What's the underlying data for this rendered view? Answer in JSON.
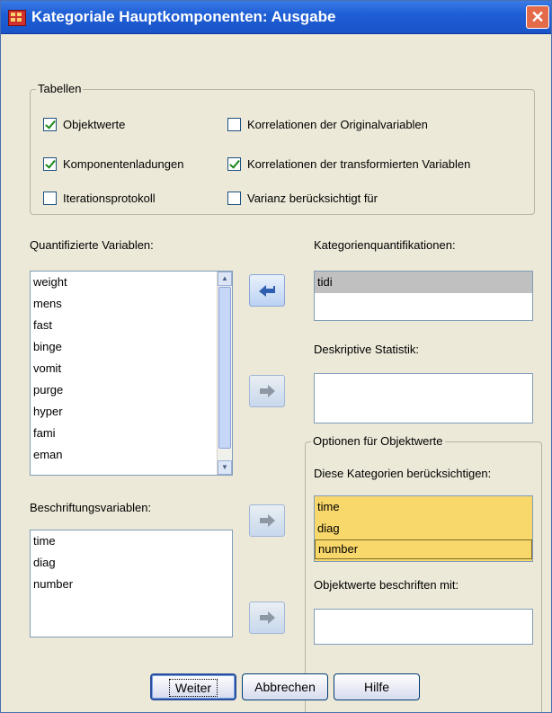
{
  "window": {
    "title": "Kategoriale Hauptkomponenten: Ausgabe",
    "close_label": "✕"
  },
  "tables_group": {
    "legend": "Tabellen",
    "checkboxes": [
      {
        "label": "Objektwerte",
        "checked": true
      },
      {
        "label": "Komponentenladungen",
        "checked": true
      },
      {
        "label": "Iterationsprotokoll",
        "checked": false
      },
      {
        "label": "Korrelationen der Originalvariablen",
        "checked": false
      },
      {
        "label": "Korrelationen der transformierten Variablen",
        "checked": true
      },
      {
        "label": "Varianz berücksichtigt für",
        "checked": false
      }
    ]
  },
  "quantified": {
    "label": "Quantifizierte Variablen:",
    "items": [
      "weight",
      "mens",
      "fast",
      "binge",
      "vomit",
      "purge",
      "hyper",
      "fami",
      "eman"
    ]
  },
  "labeling": {
    "label": "Beschriftungsvariablen:",
    "items": [
      "time",
      "diag",
      "number"
    ]
  },
  "category_quant": {
    "label": "Kategorienquantifikationen:",
    "items": [
      "tidi"
    ]
  },
  "descriptive": {
    "label": "Deskriptive Statistik:",
    "items": []
  },
  "object_options": {
    "legend": "Optionen für Objektwerte",
    "include_label": "Diese Kategorien berücksichtigen:",
    "include_items": [
      "time",
      "diag",
      "number"
    ],
    "label_with_label": "Objektwerte beschriften mit:"
  },
  "buttons": {
    "continue": "Weiter",
    "cancel": "Abbrechen",
    "help": "Hilfe"
  },
  "colors": {
    "title_bar": "#1f5fd6",
    "selection": "#f8d86b",
    "background": "#ece9d8"
  }
}
